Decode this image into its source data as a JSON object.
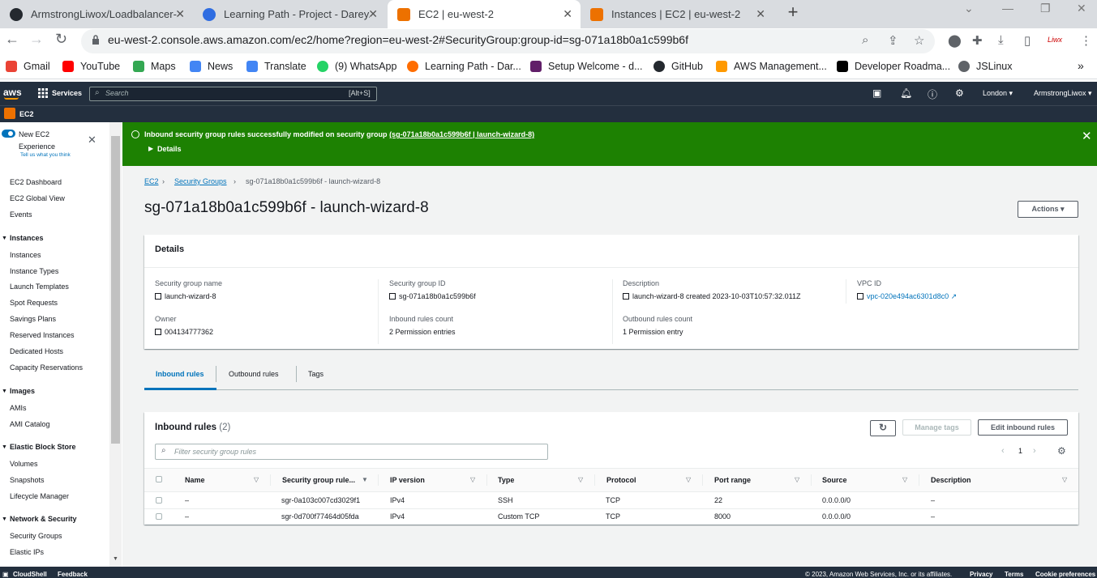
{
  "browser": {
    "tabs": [
      {
        "title": "ArmstrongLiwox/Loadbalancer-/",
        "favicon": "github-icon"
      },
      {
        "title": "Learning Path - Project - Darey.i",
        "favicon": "darey-icon"
      },
      {
        "title": "EC2 | eu-west-2",
        "favicon": "aws-icon"
      },
      {
        "title": "Instances | EC2 | eu-west-2",
        "favicon": "aws-icon"
      }
    ],
    "new_tab": "+",
    "url": "eu-west-2.console.aws.amazon.com/ec2/home?region=eu-west-2#SecurityGroup:group-id=sg-071a18b0a1c599b6f",
    "bookmarks": [
      "Gmail",
      "YouTube",
      "Maps",
      "News",
      "Translate",
      "(9) WhatsApp",
      "Learning Path - Dar...",
      "Setup Welcome - d...",
      "GitHub",
      "AWS Management...",
      "Developer Roadma...",
      "JSLinux"
    ],
    "bookmarks_more": "»"
  },
  "aws_header": {
    "logo": "aws",
    "services": "Services",
    "search_placeholder": "Search",
    "search_shortcut": "[Alt+S]",
    "region": "London ▾",
    "account": "ArmstrongLiwox ▾",
    "service_badge": "EC2"
  },
  "sidebar": {
    "new_experience": "New EC2",
    "experience": "Experience",
    "tell_us": "Tell us what you think",
    "top_items": [
      "EC2 Dashboard",
      "EC2 Global View",
      "Events"
    ],
    "sections": [
      {
        "title": "Instances",
        "items": [
          "Instances",
          "Instance Types",
          "Launch Templates",
          "Spot Requests",
          "Savings Plans",
          "Reserved Instances",
          "Dedicated Hosts",
          "Capacity Reservations"
        ]
      },
      {
        "title": "Images",
        "items": [
          "AMIs",
          "AMI Catalog"
        ]
      },
      {
        "title": "Elastic Block Store",
        "items": [
          "Volumes",
          "Snapshots",
          "Lifecycle Manager"
        ]
      },
      {
        "title": "Network & Security",
        "items": [
          "Security Groups",
          "Elastic IPs"
        ]
      }
    ]
  },
  "flash": {
    "message": "Inbound security group rules successfully modified on security group ",
    "link": "(sg-071a18b0a1c599b6f | launch-wizard-8)",
    "details": "Details",
    "color": "#1d8102"
  },
  "breadcrumb": {
    "items": [
      "EC2",
      "Security Groups",
      "sg-071a18b0a1c599b6f - launch-wizard-8"
    ]
  },
  "page": {
    "title": "sg-071a18b0a1c599b6f - launch-wizard-8",
    "actions": "Actions ▾"
  },
  "details": {
    "header": "Details",
    "fields": [
      {
        "label": "Security group name",
        "value": "launch-wizard-8"
      },
      {
        "label": "Security group ID",
        "value": "sg-071a18b0a1c599b6f"
      },
      {
        "label": "Description",
        "value": "launch-wizard-8 created 2023-10-03T10:57:32.011Z"
      },
      {
        "label": "VPC ID",
        "value": "vpc-020e494ac6301d8c0"
      },
      {
        "label": "Owner",
        "value": "004134777362"
      },
      {
        "label": "Inbound rules count",
        "value": "2 Permission entries"
      },
      {
        "label": "Outbound rules count",
        "value": "1 Permission entry"
      }
    ]
  },
  "tabs": [
    "Inbound rules",
    "Outbound rules",
    "Tags"
  ],
  "inbound": {
    "title": "Inbound rules",
    "count": "(2)",
    "manage_tags": "Manage tags",
    "edit": "Edit inbound rules",
    "filter_placeholder": "Filter security group rules",
    "page": "1",
    "columns": [
      "Name",
      "Security group rule...",
      "IP version",
      "Type",
      "Protocol",
      "Port range",
      "Source",
      "Description"
    ],
    "rows": [
      [
        "–",
        "sgr-0a103c007cd3029f1",
        "IPv4",
        "SSH",
        "TCP",
        "22",
        "0.0.0.0/0",
        "–"
      ],
      [
        "–",
        "sgr-0d700f77464d05fda",
        "IPv4",
        "Custom TCP",
        "TCP",
        "8000",
        "0.0.0.0/0",
        "–"
      ]
    ]
  },
  "footer": {
    "cloudshell": "CloudShell",
    "feedback": "Feedback",
    "copyright": "© 2023, Amazon Web Services, Inc. or its affiliates.",
    "privacy": "Privacy",
    "terms": "Terms",
    "cookies": "Cookie preferences"
  }
}
